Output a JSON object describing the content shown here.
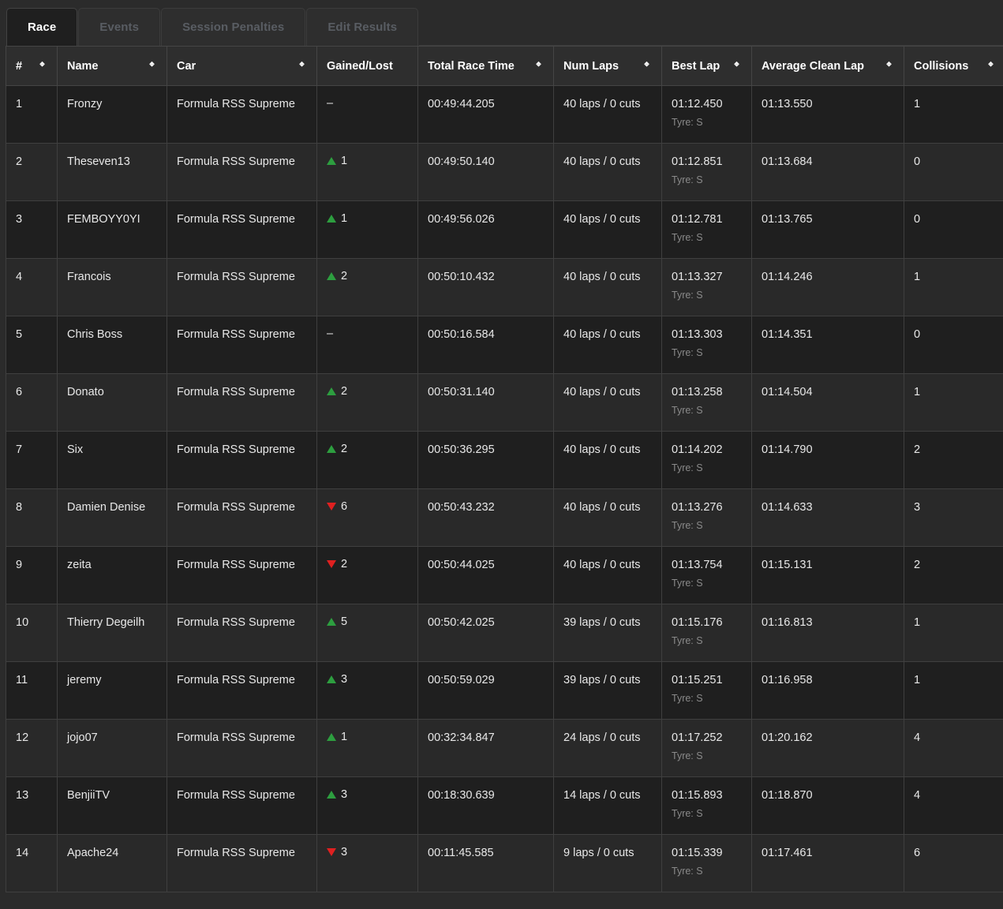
{
  "tabs": [
    {
      "label": "Race",
      "active": true
    },
    {
      "label": "Events",
      "active": false
    },
    {
      "label": "Session Penalties",
      "active": false
    },
    {
      "label": "Edit Results",
      "active": false
    }
  ],
  "colors": {
    "gain_green": "#2d9e3f",
    "loss_red": "#e02020",
    "row_odd": "#1f1f1f",
    "row_even": "#292929",
    "header_bg": "#2e2e2e",
    "page_bg": "#2b2b2b"
  },
  "table": {
    "columns": [
      {
        "label": "#",
        "sortable": true
      },
      {
        "label": "Name",
        "sortable": true
      },
      {
        "label": "Car",
        "sortable": true
      },
      {
        "label": "Gained/Lost",
        "sortable": false
      },
      {
        "label": "Total Race Time",
        "sortable": true
      },
      {
        "label": "Num Laps",
        "sortable": true
      },
      {
        "label": "Best Lap",
        "sortable": true
      },
      {
        "label": "Average Clean Lap",
        "sortable": true
      },
      {
        "label": "Collisions",
        "sortable": true
      }
    ],
    "tyre_label": "Tyre: S",
    "rows": [
      {
        "pos": "1",
        "name": "Fronzy",
        "car": "Formula RSS Supreme",
        "delta_dir": "none",
        "delta": "–",
        "total_time": "00:49:44.205",
        "laps": "40 laps / 0 cuts",
        "best_lap": "01:12.450",
        "tyre": "Tyre: S",
        "avg_clean": "01:13.550",
        "collisions": "1"
      },
      {
        "pos": "2",
        "name": "Theseven13",
        "car": "Formula RSS Supreme",
        "delta_dir": "up",
        "delta": "1",
        "total_time": "00:49:50.140",
        "laps": "40 laps / 0 cuts",
        "best_lap": "01:12.851",
        "tyre": "Tyre: S",
        "avg_clean": "01:13.684",
        "collisions": "0"
      },
      {
        "pos": "3",
        "name": "FEMBOYY0YI",
        "car": "Formula RSS Supreme",
        "delta_dir": "up",
        "delta": "1",
        "total_time": "00:49:56.026",
        "laps": "40 laps / 0 cuts",
        "best_lap": "01:12.781",
        "tyre": "Tyre: S",
        "avg_clean": "01:13.765",
        "collisions": "0"
      },
      {
        "pos": "4",
        "name": "Francois",
        "car": "Formula RSS Supreme",
        "delta_dir": "up",
        "delta": "2",
        "total_time": "00:50:10.432",
        "laps": "40 laps / 0 cuts",
        "best_lap": "01:13.327",
        "tyre": "Tyre: S",
        "avg_clean": "01:14.246",
        "collisions": "1"
      },
      {
        "pos": "5",
        "name": "Chris Boss",
        "car": "Formula RSS Supreme",
        "delta_dir": "none",
        "delta": "–",
        "total_time": "00:50:16.584",
        "laps": "40 laps / 0 cuts",
        "best_lap": "01:13.303",
        "tyre": "Tyre: S",
        "avg_clean": "01:14.351",
        "collisions": "0"
      },
      {
        "pos": "6",
        "name": "Donato",
        "car": "Formula RSS Supreme",
        "delta_dir": "up",
        "delta": "2",
        "total_time": "00:50:31.140",
        "laps": "40 laps / 0 cuts",
        "best_lap": "01:13.258",
        "tyre": "Tyre: S",
        "avg_clean": "01:14.504",
        "collisions": "1"
      },
      {
        "pos": "7",
        "name": "Six",
        "car": "Formula RSS Supreme",
        "delta_dir": "up",
        "delta": "2",
        "total_time": "00:50:36.295",
        "laps": "40 laps / 0 cuts",
        "best_lap": "01:14.202",
        "tyre": "Tyre: S",
        "avg_clean": "01:14.790",
        "collisions": "2"
      },
      {
        "pos": "8",
        "name": "Damien Denise",
        "car": "Formula RSS Supreme",
        "delta_dir": "down",
        "delta": "6",
        "total_time": "00:50:43.232",
        "laps": "40 laps / 0 cuts",
        "best_lap": "01:13.276",
        "tyre": "Tyre: S",
        "avg_clean": "01:14.633",
        "collisions": "3"
      },
      {
        "pos": "9",
        "name": "zeita",
        "car": "Formula RSS Supreme",
        "delta_dir": "down",
        "delta": "2",
        "total_time": "00:50:44.025",
        "laps": "40 laps / 0 cuts",
        "best_lap": "01:13.754",
        "tyre": "Tyre: S",
        "avg_clean": "01:15.131",
        "collisions": "2"
      },
      {
        "pos": "10",
        "name": "Thierry Degeilh",
        "car": "Formula RSS Supreme",
        "delta_dir": "up",
        "delta": "5",
        "total_time": "00:50:42.025",
        "laps": "39 laps / 0 cuts",
        "best_lap": "01:15.176",
        "tyre": "Tyre: S",
        "avg_clean": "01:16.813",
        "collisions": "1"
      },
      {
        "pos": "11",
        "name": "jeremy",
        "car": "Formula RSS Supreme",
        "delta_dir": "up",
        "delta": "3",
        "total_time": "00:50:59.029",
        "laps": "39 laps / 0 cuts",
        "best_lap": "01:15.251",
        "tyre": "Tyre: S",
        "avg_clean": "01:16.958",
        "collisions": "1"
      },
      {
        "pos": "12",
        "name": "jojo07",
        "car": "Formula RSS Supreme",
        "delta_dir": "up",
        "delta": "1",
        "total_time": "00:32:34.847",
        "laps": "24 laps / 0 cuts",
        "best_lap": "01:17.252",
        "tyre": "Tyre: S",
        "avg_clean": "01:20.162",
        "collisions": "4"
      },
      {
        "pos": "13",
        "name": "BenjiiTV",
        "car": "Formula RSS Supreme",
        "delta_dir": "up",
        "delta": "3",
        "total_time": "00:18:30.639",
        "laps": "14 laps / 0 cuts",
        "best_lap": "01:15.893",
        "tyre": "Tyre: S",
        "avg_clean": "01:18.870",
        "collisions": "4"
      },
      {
        "pos": "14",
        "name": "Apache24",
        "car": "Formula RSS Supreme",
        "delta_dir": "down",
        "delta": "3",
        "total_time": "00:11:45.585",
        "laps": "9 laps / 0 cuts",
        "best_lap": "01:15.339",
        "tyre": "Tyre: S",
        "avg_clean": "01:17.461",
        "collisions": "6"
      }
    ]
  }
}
